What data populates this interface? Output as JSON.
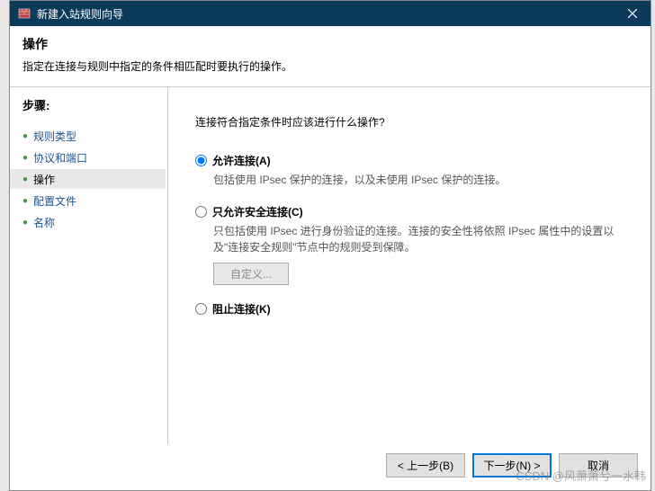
{
  "window": {
    "title": "新建入站规则向导"
  },
  "header": {
    "title": "操作",
    "description": "指定在连接与规则中指定的条件相匹配时要执行的操作。"
  },
  "sidebar": {
    "steps_label": "步骤:",
    "items": [
      {
        "label": "规则类型",
        "active": false
      },
      {
        "label": "协议和端口",
        "active": false
      },
      {
        "label": "操作",
        "active": true
      },
      {
        "label": "配置文件",
        "active": false
      },
      {
        "label": "名称",
        "active": false
      }
    ]
  },
  "content": {
    "question": "连接符合指定条件时应该进行什么操作?",
    "options": [
      {
        "label": "允许连接(A)",
        "desc": "包括使用 IPsec 保护的连接，以及未使用 IPsec 保护的连接。",
        "checked": true
      },
      {
        "label": "只允许安全连接(C)",
        "desc": "只包括使用 IPsec 进行身份验证的连接。连接的安全性将依照 IPsec 属性中的设置以及\"连接安全规则\"节点中的规则受到保障。",
        "checked": false,
        "customize": "自定义..."
      },
      {
        "label": "阻止连接(K)",
        "desc": "",
        "checked": false
      }
    ]
  },
  "footer": {
    "back": "< 上一步(B)",
    "next": "下一步(N) >",
    "cancel": "取消"
  },
  "watermark": "CSDN @风萧萧兮一水韩"
}
